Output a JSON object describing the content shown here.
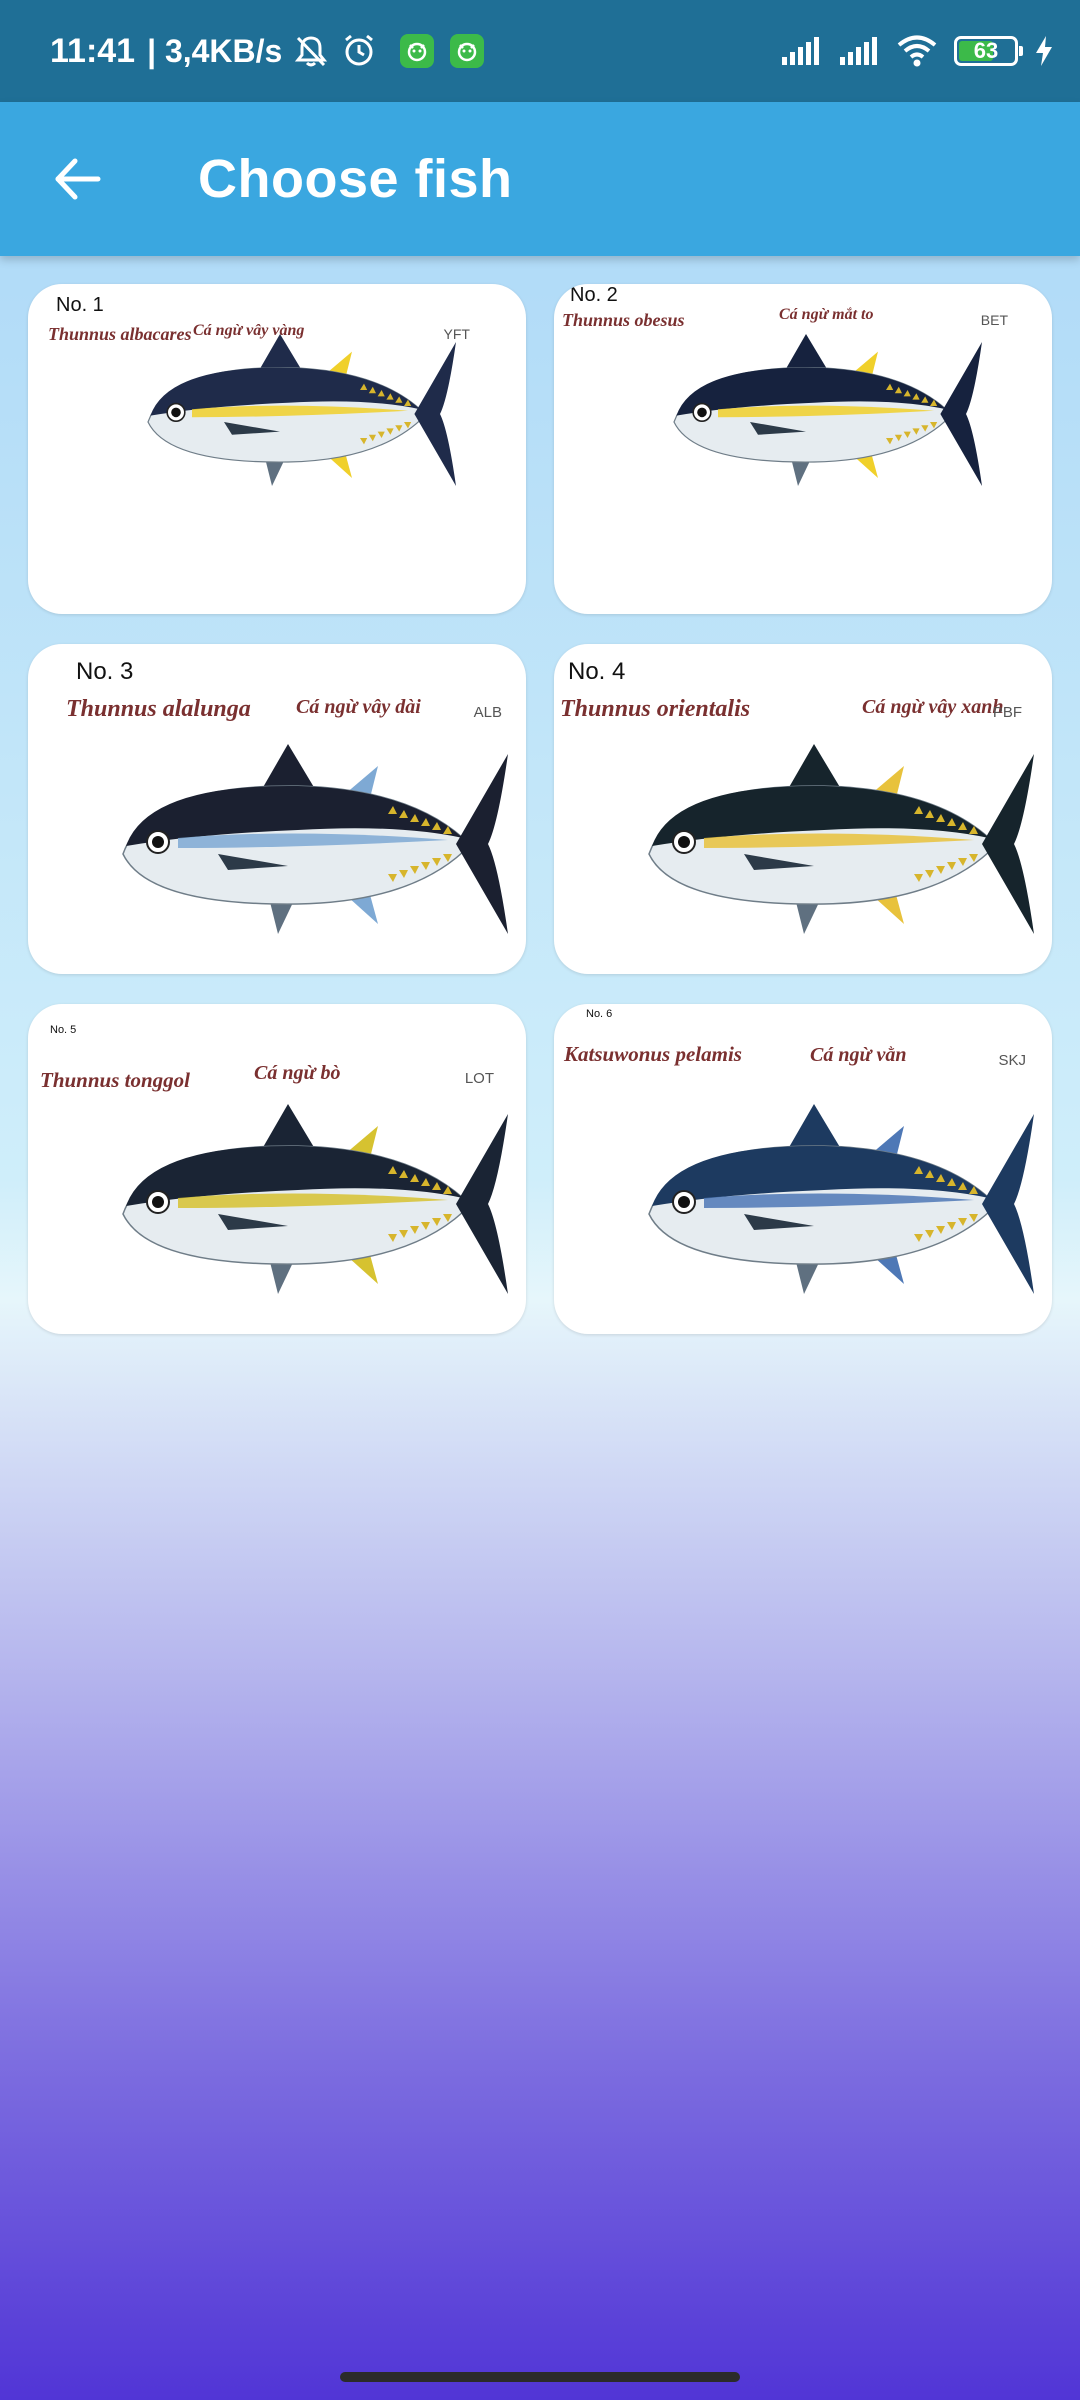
{
  "status_bar": {
    "time": "11:41",
    "network_speed": "| 3,4KB/s",
    "battery_level": "63",
    "battery_fraction": 0.63,
    "icons": [
      "mute-icon",
      "alarm-icon",
      "app-icon",
      "app-icon",
      "signal-icon",
      "signal-icon",
      "wifi-icon",
      "battery-icon",
      "charging-icon"
    ]
  },
  "app_bar": {
    "title": "Choose fish",
    "back_icon": "arrow-left-icon"
  },
  "fish": [
    {
      "number": "No. 1",
      "scientific_name": "Thunnus albacares",
      "vietnamese_name": "Cá ngừ vây vàng",
      "code": "YFT",
      "body_color": "#1f2b4a",
      "accent_color": "#f0d02a"
    },
    {
      "number": "No. 2",
      "scientific_name": "Thunnus obesus",
      "vietnamese_name": "Cá ngừ mắt to",
      "code": "BET",
      "body_color": "#16223e",
      "accent_color": "#f0d02a"
    },
    {
      "number": "No. 3",
      "scientific_name": "Thunnus alalunga",
      "vietnamese_name": "Cá ngừ vây dài",
      "code": "ALB",
      "body_color": "#1b2030",
      "accent_color": "#7ea9d4"
    },
    {
      "number": "No. 4",
      "scientific_name": "Thunnus orientalis",
      "vietnamese_name": "Cá ngừ vây xanh",
      "code": "PBF",
      "body_color": "#16242c",
      "accent_color": "#e8c23c"
    },
    {
      "number": "No. 5",
      "scientific_name": "Thunnus tonggol",
      "vietnamese_name": "Cá ngừ bò",
      "code": "LOT",
      "body_color": "#1a2434",
      "accent_color": "#d6c230"
    },
    {
      "number": "No. 6",
      "scientific_name": "Katsuwonus pelamis",
      "vietnamese_name": "Cá ngừ vằn",
      "code": "SKJ",
      "body_color": "#1d3a60",
      "accent_color": "#4e78b6"
    }
  ]
}
